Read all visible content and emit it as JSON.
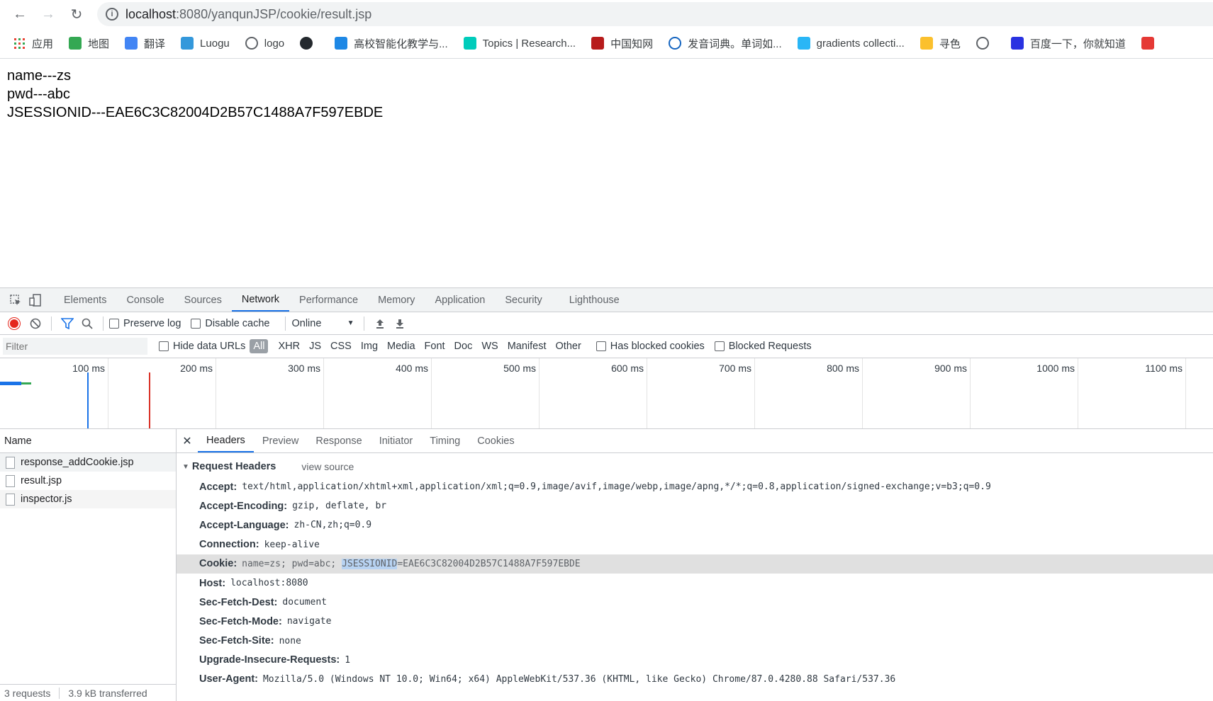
{
  "browser": {
    "url_host": "localhost",
    "url_path": ":8080/yanqunJSP/cookie/result.jsp",
    "bookmarks": [
      {
        "label": "应用",
        "icon": "apps-grid-icon",
        "color": "#ea4335"
      },
      {
        "label": "地图",
        "icon": "maps-icon",
        "color": "#34a853"
      },
      {
        "label": "翻译",
        "icon": "translate-icon",
        "color": "#4285f4"
      },
      {
        "label": "Luogu",
        "icon": "luogu-icon",
        "color": "#3498db"
      },
      {
        "label": "logo",
        "icon": "globe-icon",
        "color": "#5f6368"
      },
      {
        "label": "",
        "icon": "github-icon",
        "color": "#24292e"
      },
      {
        "label": "高校智能化教学与...",
        "icon": "edu-icon",
        "color": "#1e88e5"
      },
      {
        "label": "Topics | Research...",
        "icon": "researchgate-icon",
        "color": "#00ccbb"
      },
      {
        "label": "中国知网",
        "icon": "cnki-icon",
        "color": "#b71c1c"
      },
      {
        "label": "发音词典。单词如...",
        "icon": "ring-icon",
        "color": "#1565c0"
      },
      {
        "label": "gradients collecti...",
        "icon": "gradient-icon",
        "color": "#29b6f6"
      },
      {
        "label": "寻色",
        "icon": "color-cup-icon",
        "color": "#fbc02d"
      },
      {
        "label": "",
        "icon": "globe-icon",
        "color": "#5f6368"
      },
      {
        "label": "百度一下，你就知道",
        "icon": "baidu-paw-icon",
        "color": "#2932e1"
      },
      {
        "label": "",
        "icon": "grid-red-icon",
        "color": "#e53935"
      }
    ]
  },
  "page": {
    "lines": [
      "name---zs",
      "pwd---abc",
      "JSESSIONID---EAE6C3C82004D2B57C1488A7F597EBDE"
    ]
  },
  "devtools": {
    "tabs": [
      "Elements",
      "Console",
      "Sources",
      "Network",
      "Performance",
      "Memory",
      "Application",
      "Security",
      "Lighthouse"
    ],
    "active_tab": "Network",
    "toolbar": {
      "preserve_log": "Preserve log",
      "disable_cache": "Disable cache",
      "throttle": "Online"
    },
    "filter": {
      "placeholder": "Filter",
      "hide_data_urls": "Hide data URLs",
      "types": [
        "All",
        "XHR",
        "JS",
        "CSS",
        "Img",
        "Media",
        "Font",
        "Doc",
        "WS",
        "Manifest",
        "Other"
      ],
      "has_blocked_cookies": "Has blocked cookies",
      "blocked_requests": "Blocked Requests"
    },
    "timeline_ticks": [
      "100 ms",
      "200 ms",
      "300 ms",
      "400 ms",
      "500 ms",
      "600 ms",
      "700 ms",
      "800 ms",
      "900 ms",
      "1000 ms",
      "1100 ms"
    ],
    "names_header": "Name",
    "requests": [
      "response_addCookie.jsp",
      "result.jsp",
      "inspector.js"
    ],
    "status": {
      "requests": "3 requests",
      "transferred": "3.9 kB transferred"
    },
    "detail_tabs": [
      "Headers",
      "Preview",
      "Response",
      "Initiator",
      "Timing",
      "Cookies"
    ],
    "section_title": "Request Headers",
    "view_source": "view source",
    "headers": [
      {
        "name": "Accept:",
        "value": "text/html,application/xhtml+xml,application/xml;q=0.9,image/avif,image/webp,image/apng,*/*;q=0.8,application/signed-exchange;v=b3;q=0.9"
      },
      {
        "name": "Accept-Encoding:",
        "value": "gzip, deflate, br"
      },
      {
        "name": "Accept-Language:",
        "value": "zh-CN,zh;q=0.9"
      },
      {
        "name": "Connection:",
        "value": "keep-alive"
      },
      {
        "name": "Cookie:",
        "value_pre": "name=zs; pwd=abc; ",
        "value_sel": "JSESSIONID",
        "value_post": "=EAE6C3C82004D2B57C1488A7F597EBDE"
      },
      {
        "name": "Host:",
        "value": "localhost:8080"
      },
      {
        "name": "Sec-Fetch-Dest:",
        "value": "document"
      },
      {
        "name": "Sec-Fetch-Mode:",
        "value": "navigate"
      },
      {
        "name": "Sec-Fetch-Site:",
        "value": "none"
      },
      {
        "name": "Upgrade-Insecure-Requests:",
        "value": "1"
      },
      {
        "name": "User-Agent:",
        "value": "Mozilla/5.0 (Windows NT 10.0; Win64; x64) AppleWebKit/537.36 (KHTML, like Gecko) Chrome/87.0.4280.88 Safari/537.36"
      }
    ]
  }
}
